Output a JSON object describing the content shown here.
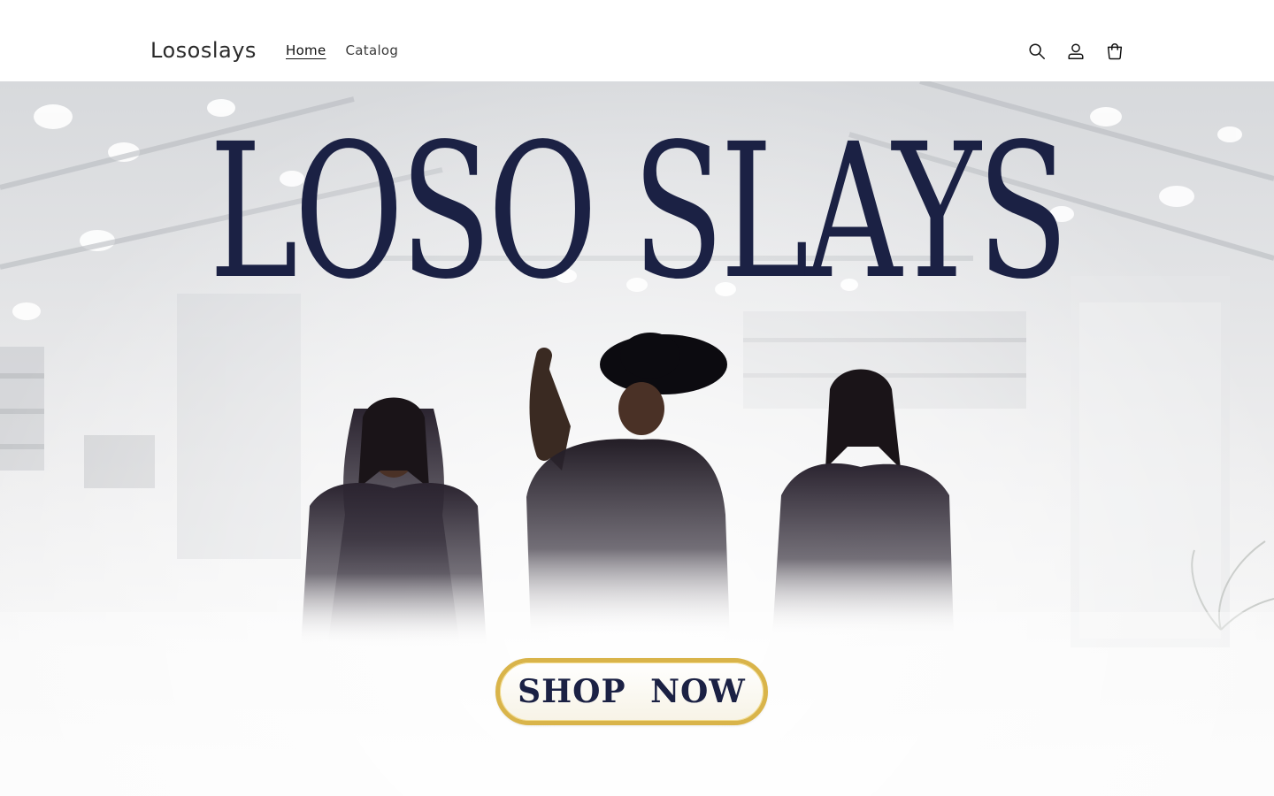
{
  "header": {
    "logo": "Lososlays",
    "nav": [
      {
        "label": "Home",
        "active": true
      },
      {
        "label": "Catalog",
        "active": false
      }
    ],
    "icons": [
      "search-icon",
      "account-icon",
      "cart-icon"
    ]
  },
  "hero": {
    "brand_title": "LOSO SLAYS",
    "cta_label": "SHOP NOW",
    "colors": {
      "navy": "#1b2144",
      "gold": "#d9b44a"
    }
  }
}
